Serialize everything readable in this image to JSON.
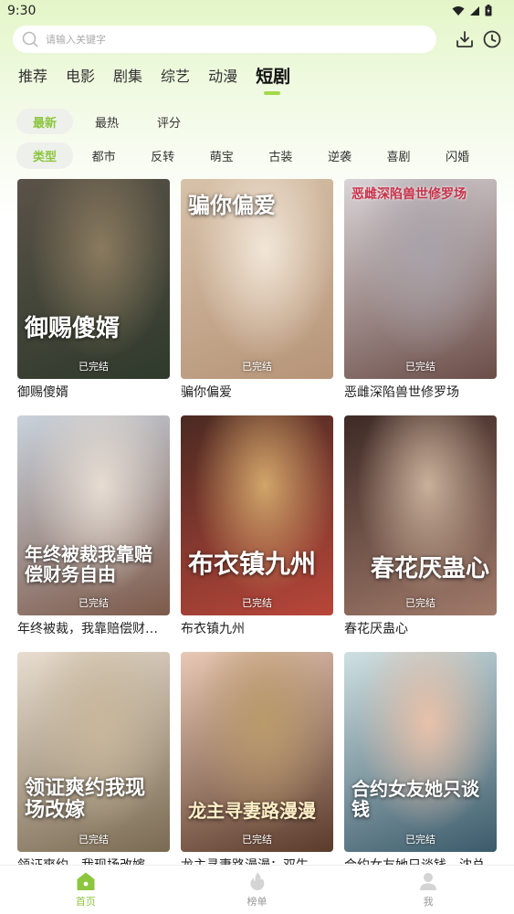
{
  "status_bar": {
    "time": "9:30"
  },
  "search": {
    "placeholder": "请输入关键字"
  },
  "category_tabs": [
    {
      "label": "推荐",
      "active": false
    },
    {
      "label": "电影",
      "active": false
    },
    {
      "label": "剧集",
      "active": false
    },
    {
      "label": "综艺",
      "active": false
    },
    {
      "label": "动漫",
      "active": false
    },
    {
      "label": "短剧",
      "active": true
    }
  ],
  "sort_chips": [
    {
      "label": "最新",
      "active": true
    },
    {
      "label": "最热",
      "active": false
    },
    {
      "label": "评分",
      "active": false
    }
  ],
  "genre_chips": [
    {
      "label": "类型",
      "active": true
    },
    {
      "label": "都市",
      "active": false
    },
    {
      "label": "反转",
      "active": false
    },
    {
      "label": "萌宝",
      "active": false
    },
    {
      "label": "古装",
      "active": false
    },
    {
      "label": "逆袭",
      "active": false
    },
    {
      "label": "喜剧",
      "active": false
    },
    {
      "label": "闪婚",
      "active": false
    }
  ],
  "items": [
    {
      "title": "御赐傻婿",
      "status": "已完结",
      "poster_text": "御赐傻婿",
      "colors": [
        "#5a5248",
        "#2f3a2c",
        "#8a7a5e"
      ]
    },
    {
      "title": "骗你偏爱",
      "status": "已完结",
      "poster_text": "骗你偏爱",
      "colors": [
        "#d7c2a9",
        "#b69478",
        "#f2e6d8"
      ]
    },
    {
      "title": "恶雌深陷兽世修罗场",
      "status": "已完结",
      "poster_text": "恶雌深陷兽世修罗场",
      "colors": [
        "#d9d4d8",
        "#6b4d47",
        "#a8a2a8"
      ]
    },
    {
      "title": "年终被裁，我靠赔偿财务自由",
      "status": "已完结",
      "poster_text": "年终被裁我靠赔偿财务自由",
      "colors": [
        "#c9d2dc",
        "#7d5a4a",
        "#e6dcd2"
      ]
    },
    {
      "title": "布衣镇九州",
      "status": "已完结",
      "poster_text": "布衣镇九州",
      "colors": [
        "#4a2a22",
        "#b9463a",
        "#d1a56a"
      ]
    },
    {
      "title": "春花厌蛊心",
      "status": "已完结",
      "poster_text": "春花厌蛊心",
      "colors": [
        "#3e2a26",
        "#a07a6a",
        "#c9b09a"
      ]
    },
    {
      "title": "领证爽约，我现场改嫁",
      "status": "已完结",
      "poster_text": "领证爽约我现场改嫁",
      "colors": [
        "#e8ddcf",
        "#7a6a52",
        "#c8b79c"
      ]
    },
    {
      "title": "龙主寻妻路漫漫：双生萌宝觉醒翻天",
      "status": "已完结",
      "poster_text": "龙主寻妻路漫漫",
      "colors": [
        "#e9c8b5",
        "#5a3a2a",
        "#b99a6a"
      ]
    },
    {
      "title": "合约女友她只谈钱，沈总",
      "status": "已完结",
      "poster_text": "合约女友她只谈钱",
      "colors": [
        "#cfe0e2",
        "#3b5a6a",
        "#e8c1a9"
      ]
    }
  ],
  "bottom_nav": [
    {
      "label": "首页",
      "active": true
    },
    {
      "label": "榜单",
      "active": false
    },
    {
      "label": "我",
      "active": false
    }
  ],
  "theme": {
    "accent": "#8cc63f",
    "accent_bar": "#a3d94a",
    "chip_bg": "#eef0ec"
  }
}
